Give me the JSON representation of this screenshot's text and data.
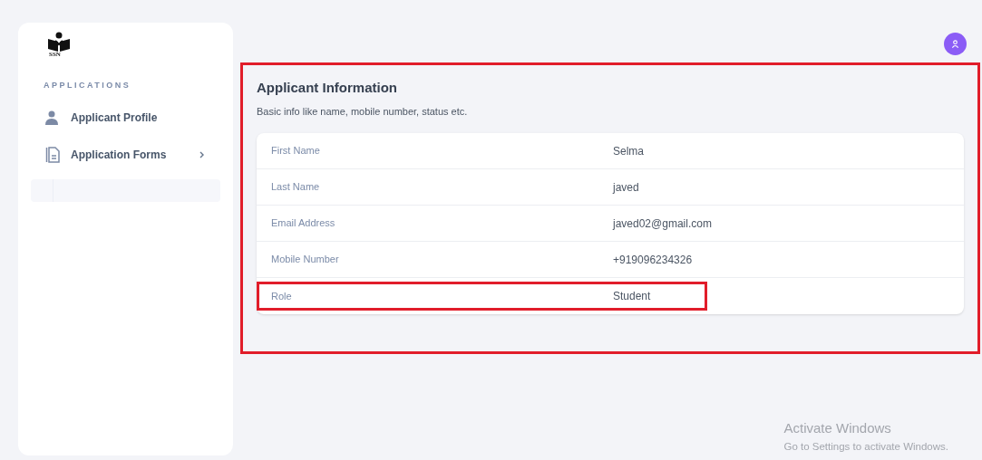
{
  "sidebar": {
    "logo_text": "SSN",
    "section_title": "APPLICATIONS",
    "items": [
      {
        "label": "Applicant Profile",
        "has_submenu": false
      },
      {
        "label": "Application Forms",
        "has_submenu": true
      }
    ]
  },
  "section": {
    "title": "Applicant Information",
    "subtitle": "Basic info like name, mobile number, status etc.",
    "highlighted": true,
    "fields": [
      {
        "label": "First Name",
        "value": "Selma",
        "highlighted": false
      },
      {
        "label": "Last Name",
        "value": "javed",
        "highlighted": false
      },
      {
        "label": "Email Address",
        "value": "javed02@gmail.com",
        "highlighted": false
      },
      {
        "label": "Mobile Number",
        "value": "+919096234326",
        "highlighted": false
      },
      {
        "label": "Role",
        "value": "Student",
        "highlighted": true
      }
    ]
  },
  "os_notice": {
    "title": "Activate Windows",
    "text": "Go to Settings to activate Windows."
  }
}
